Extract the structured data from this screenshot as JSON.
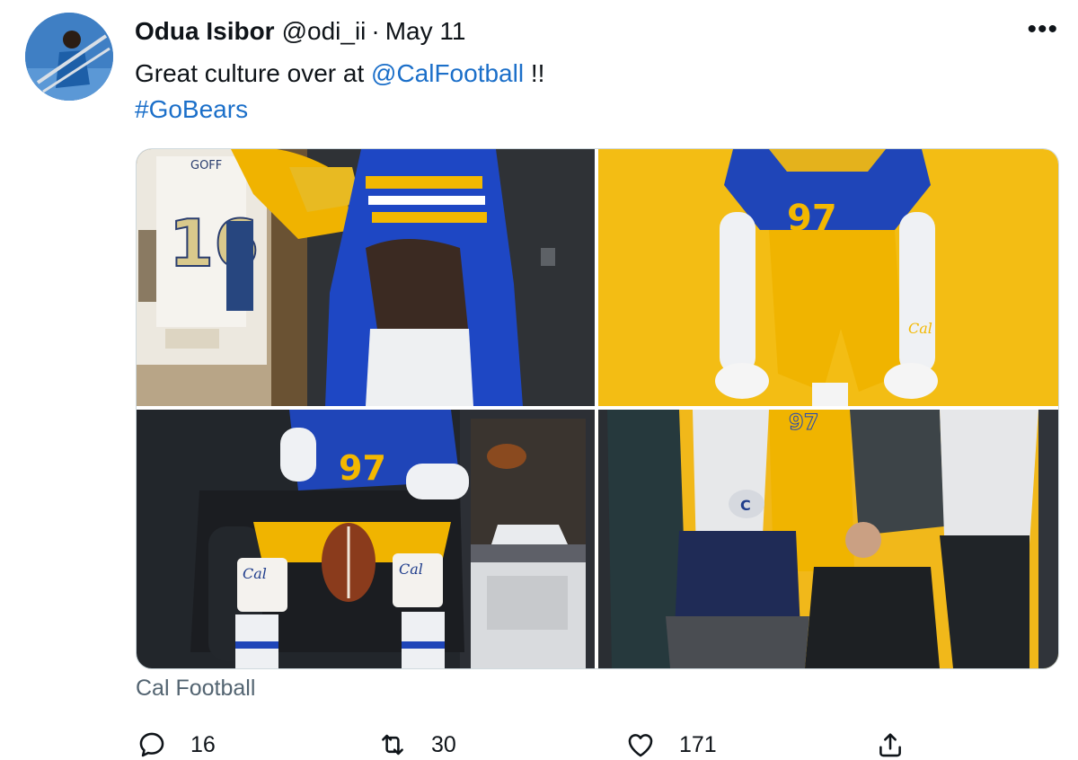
{
  "tweet": {
    "display_name": "Odua Isibor",
    "handle": "@odi_ii",
    "separator": "·",
    "date": "May 11",
    "more_label": "•••",
    "text_prefix": "Great culture over at ",
    "mention": "@CalFootball",
    "text_suffix": " !!",
    "hashtag": "#GoBears",
    "caption": "Cal Football"
  },
  "media": {
    "photos": [
      {
        "name": "locker-room-jersey-photo"
      },
      {
        "name": "player-number-97-yellow-backdrop-photo"
      },
      {
        "name": "player-seated-with-football-photo"
      },
      {
        "name": "group-photo-with-coaches"
      }
    ],
    "jersey_text": {
      "nameplate": "GOFF",
      "number": "16"
    },
    "player_number": "97",
    "cal_logo": "Cal",
    "cap_letter": "C"
  },
  "actions": {
    "reply_count": "16",
    "retweet_count": "30",
    "like_count": "171",
    "reply_icon": "reply-icon",
    "retweet_icon": "retweet-icon",
    "like_icon": "heart-icon",
    "share_icon": "share-icon"
  },
  "colors": {
    "link": "#1b6fc9",
    "cal_blue": "#1f3fa8",
    "cal_gold": "#f2b705",
    "muted": "#536471"
  }
}
